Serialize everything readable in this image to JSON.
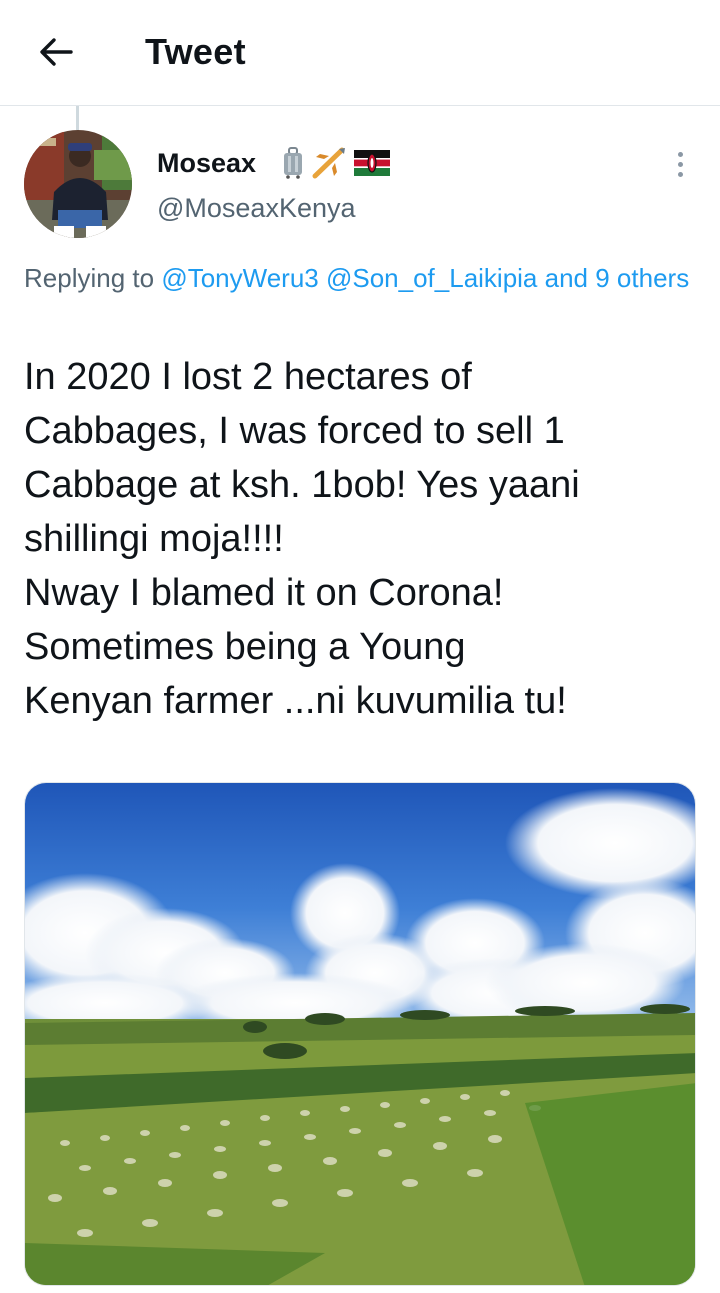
{
  "header": {
    "title": "Tweet",
    "back_icon": "arrow-left-icon"
  },
  "author": {
    "name": "Moseax",
    "handle": "@MoseaxKenya",
    "name_emojis": [
      "suitcase-emoji",
      "airplane-emoji",
      "kenya-flag-emoji"
    ]
  },
  "reply": {
    "prefix": "Replying to",
    "mention_1": "@TonyWeru3",
    "mention_2": "@Son_of_Laikipia",
    "others": "and 9 others"
  },
  "tweet": {
    "lines": [
      "In 2020 I lost 2 hectares of",
      "Cabbages, I was forced to sell 1",
      "Cabbage at ksh. 1bob! Yes yaani",
      "shillingi moja!!!!",
      "Nway I blamed it on Corona!",
      "Sometimes  being a  Young",
      "Kenyan farmer ...ni kuvumilia tu!"
    ]
  },
  "colors": {
    "link": "#1d9bf0",
    "secondary_text": "#536471",
    "primary_text": "#0f1419",
    "divider": "#e1e6ea"
  }
}
